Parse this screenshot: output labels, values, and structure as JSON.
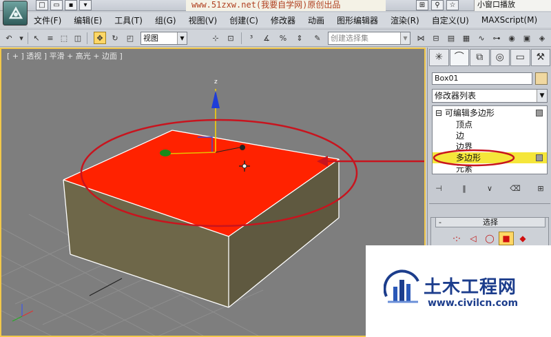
{
  "title_bar": {
    "title": "www.51zxw.net(我要自学网)原创出品",
    "mini_window_button": "小窗口播放"
  },
  "menu": {
    "items": [
      "文件(F)",
      "编辑(E)",
      "工具(T)",
      "组(G)",
      "视图(V)",
      "创建(C)",
      "修改器",
      "动画",
      "图形编辑器",
      "渲染(R)",
      "自定义(U)",
      "MAXScript(M)"
    ]
  },
  "toolbar": {
    "reference_coord": "视图",
    "named_selection_placeholder": "创建选择集"
  },
  "viewport": {
    "label": "[ + ] 透视 ] 平滑 + 高光 + 边面 ]",
    "gizmo_axis_label": "z"
  },
  "command_panel": {
    "object_name": "Box01",
    "modifier_list": "修改器列表",
    "stack": {
      "root": "可编辑多边形",
      "subobjects": [
        "顶点",
        "边",
        "边界",
        "多边形",
        "元素"
      ],
      "selected_index": 3
    },
    "rollout_title": "选择",
    "rollout_toggle": "-"
  },
  "watermark": {
    "name": "土木工程网",
    "url": "www.civilcn.com"
  },
  "colors": {
    "selected_face": "#ff2200",
    "box_side": "#6d6649",
    "highlight": "#f5e63a",
    "annotation": "#c8141e",
    "viewport_border": "#f2c84a"
  }
}
